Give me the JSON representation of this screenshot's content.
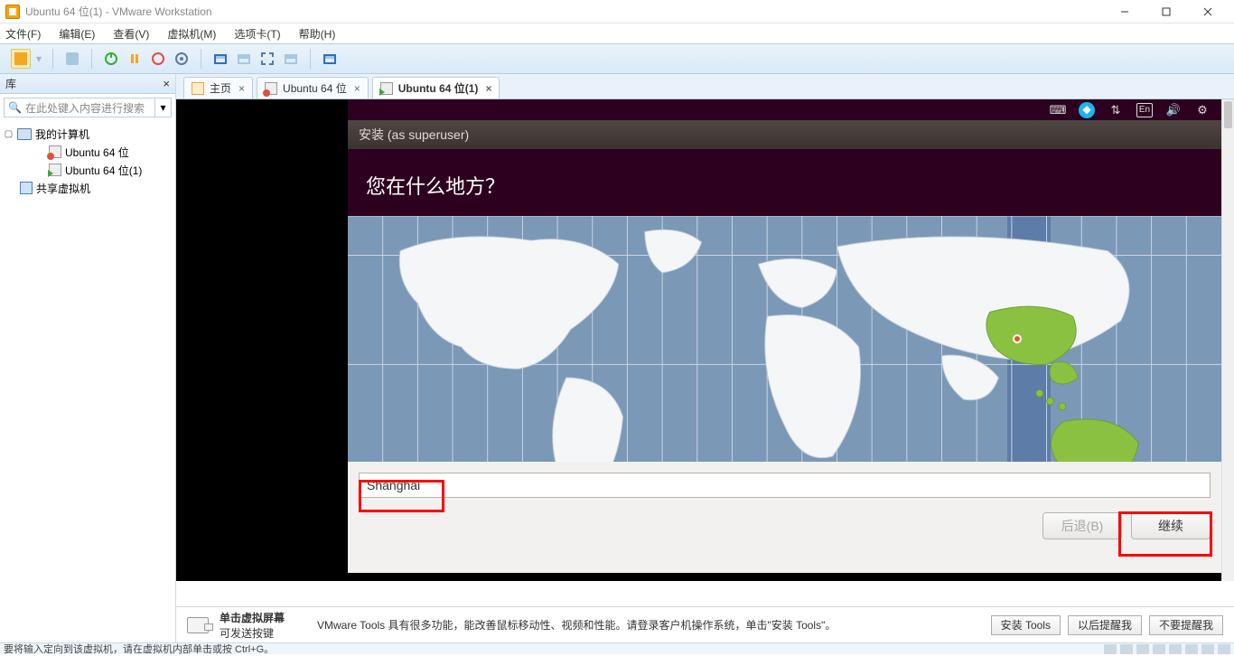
{
  "window": {
    "title": "Ubuntu 64 位(1) - VMware Workstation"
  },
  "menu": {
    "file": "文件(F)",
    "edit": "编辑(E)",
    "view": "查看(V)",
    "vm": "虚拟机(M)",
    "tabs": "选项卡(T)",
    "help": "帮助(H)"
  },
  "sidebar": {
    "title": "库",
    "search_placeholder": "在此处键入内容进行搜索",
    "my_computer": "我的计算机",
    "vm1": "Ubuntu 64 位",
    "vm2": "Ubuntu 64 位(1)",
    "shared": "共享虚拟机"
  },
  "tabs": {
    "home": "主页",
    "vm1": "Ubuntu 64 位",
    "vm2": "Ubuntu 64 位(1)"
  },
  "installer": {
    "top_lang": "En",
    "titlebar": "安装 (as superuser)",
    "heading": "您在什么地方？",
    "timezone_value": "Shanghai",
    "back_label": "后退(B)",
    "continue_label": "继续"
  },
  "hint": {
    "click_title": "单击虚拟屏幕",
    "click_sub": "可发送按键",
    "tools_msg": "VMware Tools 具有很多功能，能改善鼠标移动性、视频和性能。请登录客户机操作系统，单击\"安装 Tools\"。",
    "install": "安装 Tools",
    "remind": "以后提醒我",
    "never": "不要提醒我"
  },
  "status": {
    "text": "要将输入定向到该虚拟机，请在虚拟机内部单击或按 Ctrl+G。"
  }
}
